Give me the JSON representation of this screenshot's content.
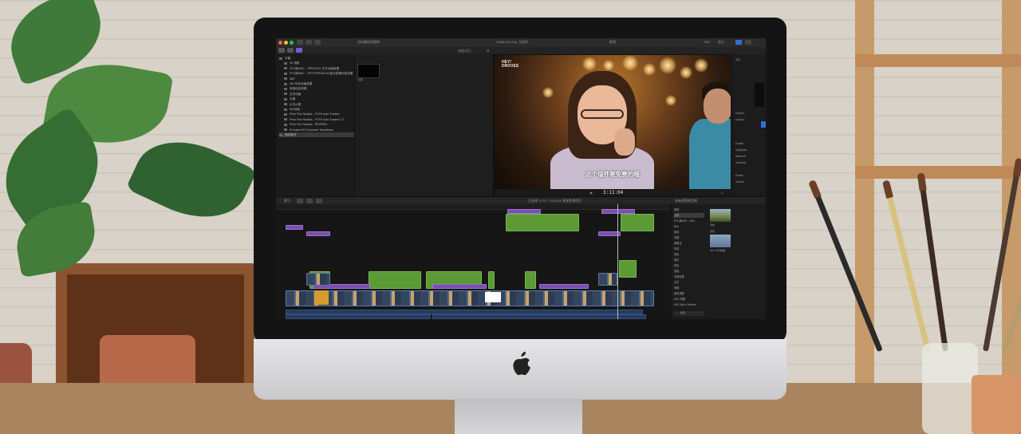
{
  "app": {
    "toolbar_title": "无标题的资源库",
    "viewer_title": "1080p HD 25p, 立体声",
    "viewer_zoom": "70%",
    "viewer_view": "显示",
    "viewer_project": "影视",
    "browser_filter": "仅显示已...",
    "timecode": "3:11:04",
    "timeline_title": "已选择 17:07 / 03:53:00 基准剪辑项目",
    "timeline_index": "索引",
    "watermark_line1": "HEY!",
    "watermark_line2": "DROVES",
    "subtitle": "这个插件是免费的哦"
  },
  "library": {
    "items": [
      {
        "label": "字幕",
        "level": 0,
        "selected": false
      },
      {
        "label": "4K 电影",
        "level": 1,
        "selected": false
      },
      {
        "label": "974 款MAC – PROTACK 文字动画效果",
        "level": 1,
        "selected": false
      },
      {
        "label": "974 款MAC – PFS PRISTACKS适合剪辑动态效果",
        "level": 1,
        "selected": false
      },
      {
        "label": "360°",
        "level": 1,
        "selected": false
      },
      {
        "label": "MG 形状动画效果",
        "level": 1,
        "selected": false
      },
      {
        "label": "电视动态效果",
        "level": 1,
        "selected": false
      },
      {
        "label": "文字动画",
        "level": 1,
        "selected": false
      },
      {
        "label": "字幕",
        "level": 1,
        "selected": false
      },
      {
        "label": "片头片尾",
        "level": 1,
        "selected": false
      },
      {
        "label": "MG动画",
        "level": 1,
        "selected": false
      },
      {
        "label": "Pixel Film Studios - FCPX Auto Tracker",
        "level": 1,
        "selected": false
      },
      {
        "label": "Pixel Film Studios - FCPX Auto Tracker 2.1",
        "level": 1,
        "selected": false
      },
      {
        "label": "Pixel Film Studios - PROPEN",
        "level": 1,
        "selected": false
      },
      {
        "label": "PremiumVFX Dynamic Transitions",
        "level": 1,
        "selected": false
      },
      {
        "label": "通用素材",
        "level": 0,
        "selected": true
      }
    ],
    "thumb_caption": "标题"
  },
  "inspector": {
    "labels": [
      "文本",
      "Position",
      "Opacity",
      "Enable",
      "Highlights",
      "Midtones",
      "Shadows",
      "Enable",
      "Opacity"
    ]
  },
  "effects": {
    "header": "所有视频和音频",
    "items": [
      {
        "label": "视频",
        "selected": false
      },
      {
        "label": "全部",
        "selected": true
      },
      {
        "label": "974 款MAC – Win...",
        "selected": false
      },
      {
        "label": "Blur",
        "selected": false
      },
      {
        "label": "颜色",
        "selected": false
      },
      {
        "label": "光照",
        "selected": false
      },
      {
        "label": "风格化",
        "selected": false
      },
      {
        "label": "失真",
        "selected": false
      },
      {
        "label": "拼贴",
        "selected": false
      },
      {
        "label": "基本",
        "selected": false
      },
      {
        "label": "怀旧",
        "selected": false
      },
      {
        "label": "漫画",
        "selected": false
      },
      {
        "label": "光源效果",
        "selected": false
      },
      {
        "label": "文字",
        "selected": false
      },
      {
        "label": "风格",
        "selected": false
      },
      {
        "label": "颜色调整",
        "selected": false
      },
      {
        "label": "MGJ 风格",
        "selected": false
      },
      {
        "label": "MGJ Blur & Render",
        "selected": false
      }
    ],
    "thumb1_label": "调整",
    "thumb2_label": "渐变",
    "thumb2_caption": "360° 背景模糊",
    "search_placeholder": "搜索"
  },
  "colors": {
    "clip_green": "#5b9a35",
    "clip_purple": "#7a4fb0",
    "clip_blue": "#2f4f7a",
    "ui_bg": "#1e1e1e"
  }
}
